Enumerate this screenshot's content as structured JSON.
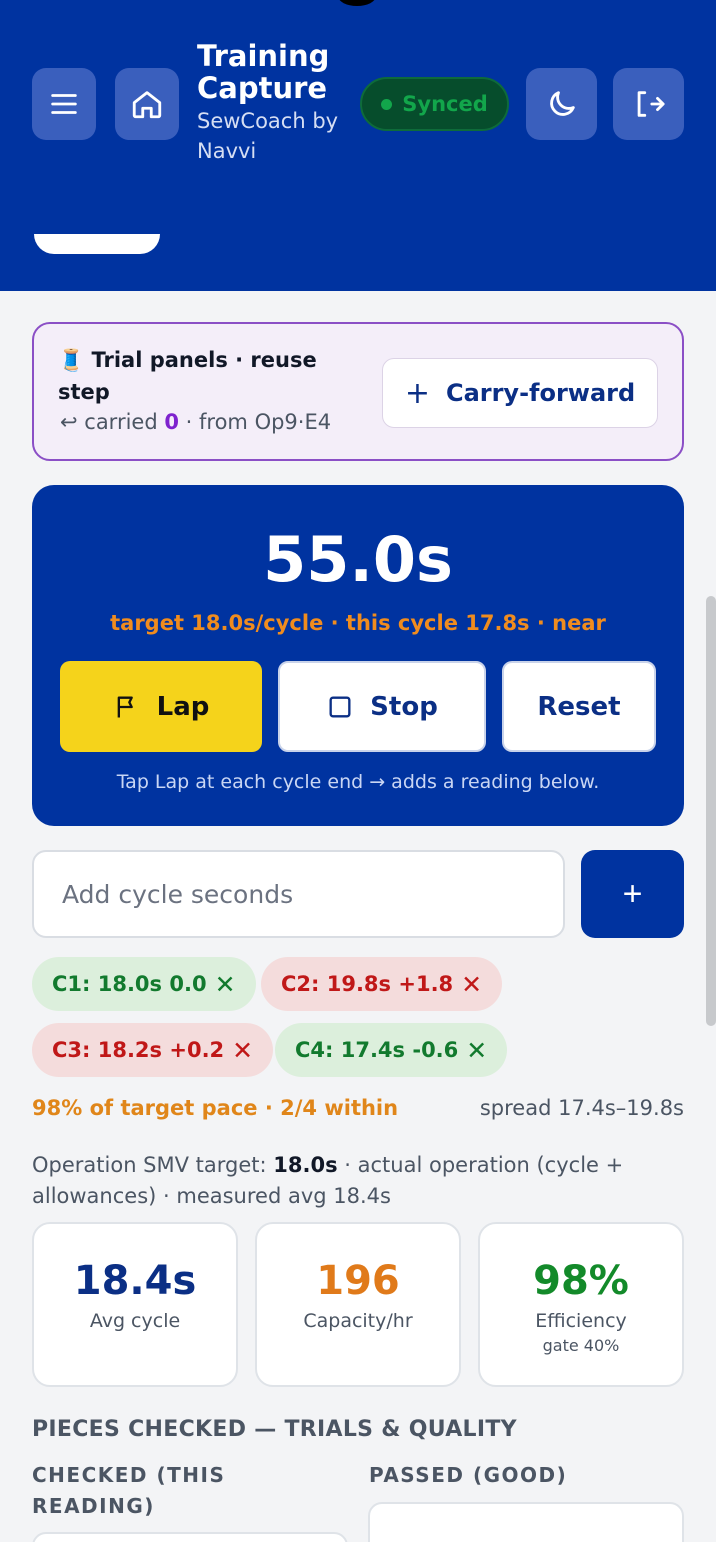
{
  "header": {
    "title": "Training Capture",
    "subtitle": "SewCoach by Navvi",
    "sync_status": "Synced",
    "menu_icon": "menu-icon",
    "home_icon": "home-icon",
    "theme_icon": "moon-icon",
    "logout_icon": "logout-icon",
    "colors": {
      "bar": "#0033a0",
      "synced": "#12a64b"
    }
  },
  "trial": {
    "icon": "🧵",
    "title": "Trial panels · reuse step",
    "carried_prefix": "↩ carried",
    "carried_count": "0",
    "carried_from": "· from Op9·E4",
    "carry_button_label": "Carry-forward",
    "carry_button_plus": "+"
  },
  "timer": {
    "value": "55.0s",
    "target_line": "target 18.0s/cycle · this cycle 17.8s · near",
    "lap_label": "Lap",
    "stop_label": "Stop",
    "reset_label": "Reset",
    "hint": "Tap Lap at each cycle end → adds a reading below."
  },
  "add_cycle": {
    "placeholder": "Add cycle seconds",
    "button_label": "+"
  },
  "cycles": [
    {
      "label": "C1: 18.0s 0.0",
      "status": "good"
    },
    {
      "label": "C2: 19.8s +1.8",
      "status": "bad"
    },
    {
      "label": "C3: 18.2s +0.2",
      "status": "bad"
    },
    {
      "label": "C4: 17.4s -0.6",
      "status": "good"
    }
  ],
  "summary": {
    "pace": "98% of target pace · 2/4 within",
    "spread": "spread 17.4s–19.8s"
  },
  "smv": {
    "prefix": "Operation SMV target:",
    "value": "18.0s",
    "suffix": "· actual operation (cycle + allowances) · measured avg 18.4s"
  },
  "stats": [
    {
      "value": "18.4s",
      "label": "Avg cycle",
      "sub": "",
      "color": "#0b2f85"
    },
    {
      "value": "196",
      "label": "Capacity/hr",
      "sub": "",
      "color": "#e07a1a"
    },
    {
      "value": "98%",
      "label": "Efficiency",
      "sub": "gate 40%",
      "color": "#138a2a"
    }
  ],
  "pieces": {
    "section_title": "PIECES CHECKED — TRIALS & QUALITY",
    "checked_label": "CHECKED (THIS READING)",
    "passed_label": "PASSED (GOOD)"
  }
}
